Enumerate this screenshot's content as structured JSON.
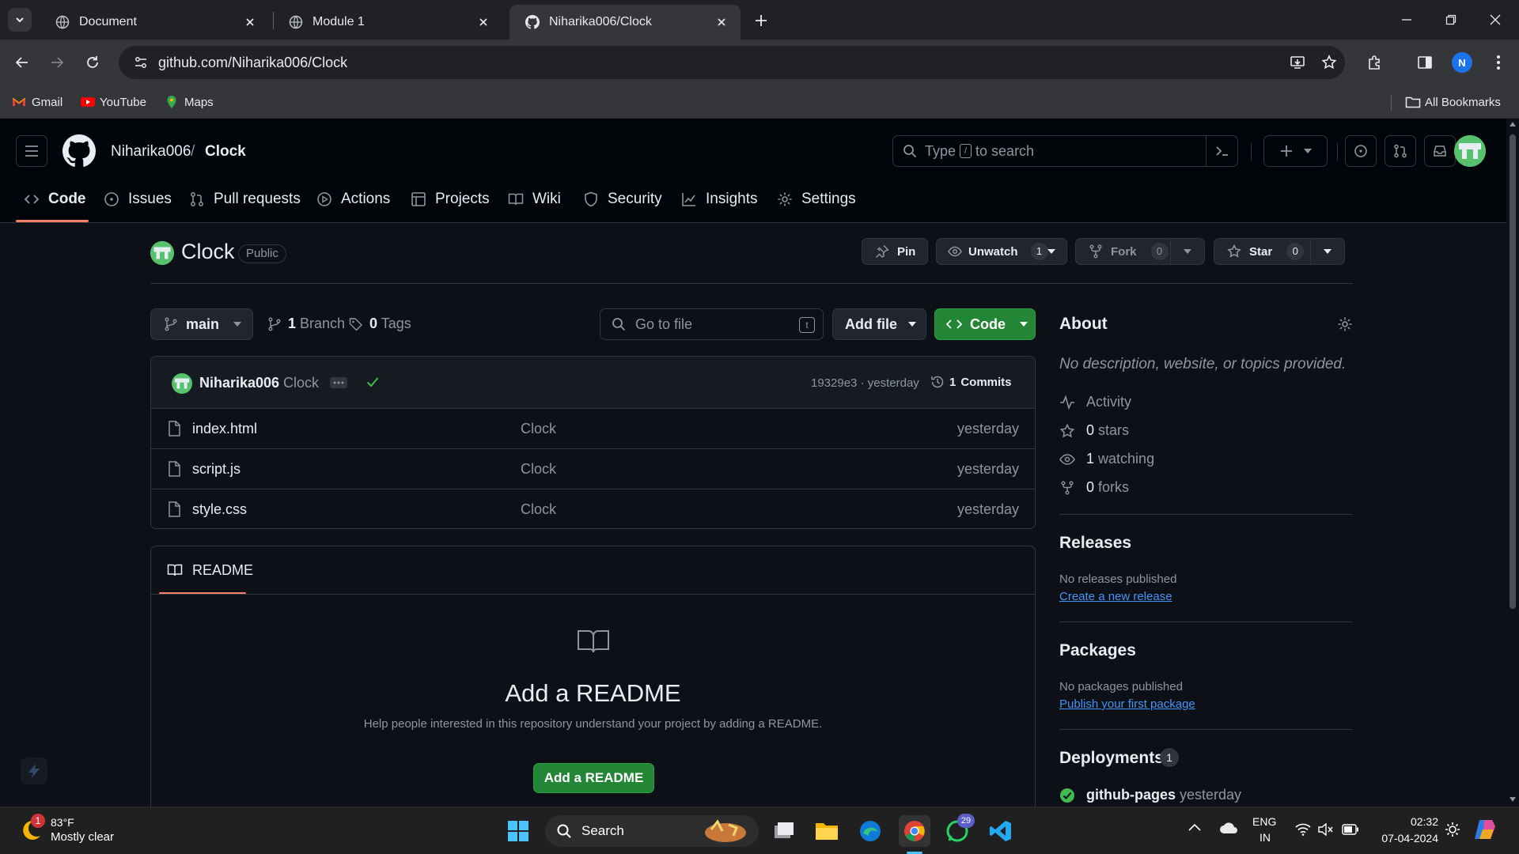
{
  "browser": {
    "tabs": [
      {
        "title": "Document",
        "active": false
      },
      {
        "title": "Module 1",
        "active": false
      },
      {
        "title": "Niharika006/Clock",
        "active": true
      }
    ],
    "url": "github.com/Niharika006/Clock",
    "profile_initial": "N",
    "bookmarks": [
      {
        "label": "Gmail",
        "icon": "gmail-icon"
      },
      {
        "label": "YouTube",
        "icon": "youtube-icon"
      },
      {
        "label": "Maps",
        "icon": "maps-icon"
      }
    ],
    "all_bookmarks": "All Bookmarks"
  },
  "header": {
    "owner": "Niharika006",
    "separator": "/",
    "repo": "Clock",
    "search_prefix": "Type",
    "search_kbd": "/",
    "search_suffix": "to search"
  },
  "repo_nav": [
    {
      "label": "Code",
      "icon": "code-icon",
      "active": true
    },
    {
      "label": "Issues",
      "icon": "issue-icon"
    },
    {
      "label": "Pull requests",
      "icon": "pull-request-icon"
    },
    {
      "label": "Actions",
      "icon": "actions-icon"
    },
    {
      "label": "Projects",
      "icon": "projects-icon"
    },
    {
      "label": "Wiki",
      "icon": "wiki-icon"
    },
    {
      "label": "Security",
      "icon": "shield-icon"
    },
    {
      "label": "Insights",
      "icon": "graph-icon"
    },
    {
      "label": "Settings",
      "icon": "gear-icon"
    }
  ],
  "repo": {
    "name": "Clock",
    "visibility": "Public",
    "pin_label": "Pin",
    "unwatch_label": "Unwatch",
    "watch_count": "1",
    "fork_label": "Fork",
    "fork_count": "0",
    "star_label": "Star",
    "star_count": "0"
  },
  "toolbar": {
    "branch": "main",
    "branches_count": "1",
    "branches_label": "Branch",
    "tags_count": "0",
    "tags_label": "Tags",
    "goto_placeholder": "Go to file",
    "goto_kbd": "t",
    "add_file_label": "Add file",
    "code_label": "Code"
  },
  "commit": {
    "author": "Niharika006",
    "message": "Clock",
    "status": "success",
    "hash": "19329e3",
    "hash_sep": "·",
    "time": "yesterday",
    "commits_count": "1",
    "commits_label": "Commits"
  },
  "files": [
    {
      "name": "index.html",
      "message": "Clock",
      "date": "yesterday"
    },
    {
      "name": "script.js",
      "message": "Clock",
      "date": "yesterday"
    },
    {
      "name": "style.css",
      "message": "Clock",
      "date": "yesterday"
    }
  ],
  "readme": {
    "tab_label": "README",
    "title": "Add a README",
    "subtitle": "Help people interested in this repository understand your project by adding a README.",
    "button": "Add a README"
  },
  "about": {
    "heading": "About",
    "description": "No description, website, or topics provided.",
    "activity": "Activity",
    "stars_count": "0",
    "stars_label": "stars",
    "watching_count": "1",
    "watching_label": "watching",
    "forks_count": "0",
    "forks_label": "forks"
  },
  "releases": {
    "heading": "Releases",
    "empty": "No releases published",
    "link": "Create a new release"
  },
  "packages": {
    "heading": "Packages",
    "empty": "No packages published",
    "link": "Publish your first package"
  },
  "deployments": {
    "heading": "Deployments",
    "count": "1",
    "env": "github-pages",
    "time": "yesterday"
  },
  "taskbar": {
    "weather_badge": "1",
    "temperature": "83°F",
    "weather": "Mostly clear",
    "search_label": "Search",
    "whatsapp_badge": "29",
    "lang_top": "ENG",
    "lang_bottom": "IN",
    "time": "02:32",
    "date": "07-04-2024"
  },
  "colors": {
    "accent_green": "#238636",
    "link_blue": "#4493f8",
    "tab_underline": "#f78166",
    "bg": "#0d1117"
  }
}
